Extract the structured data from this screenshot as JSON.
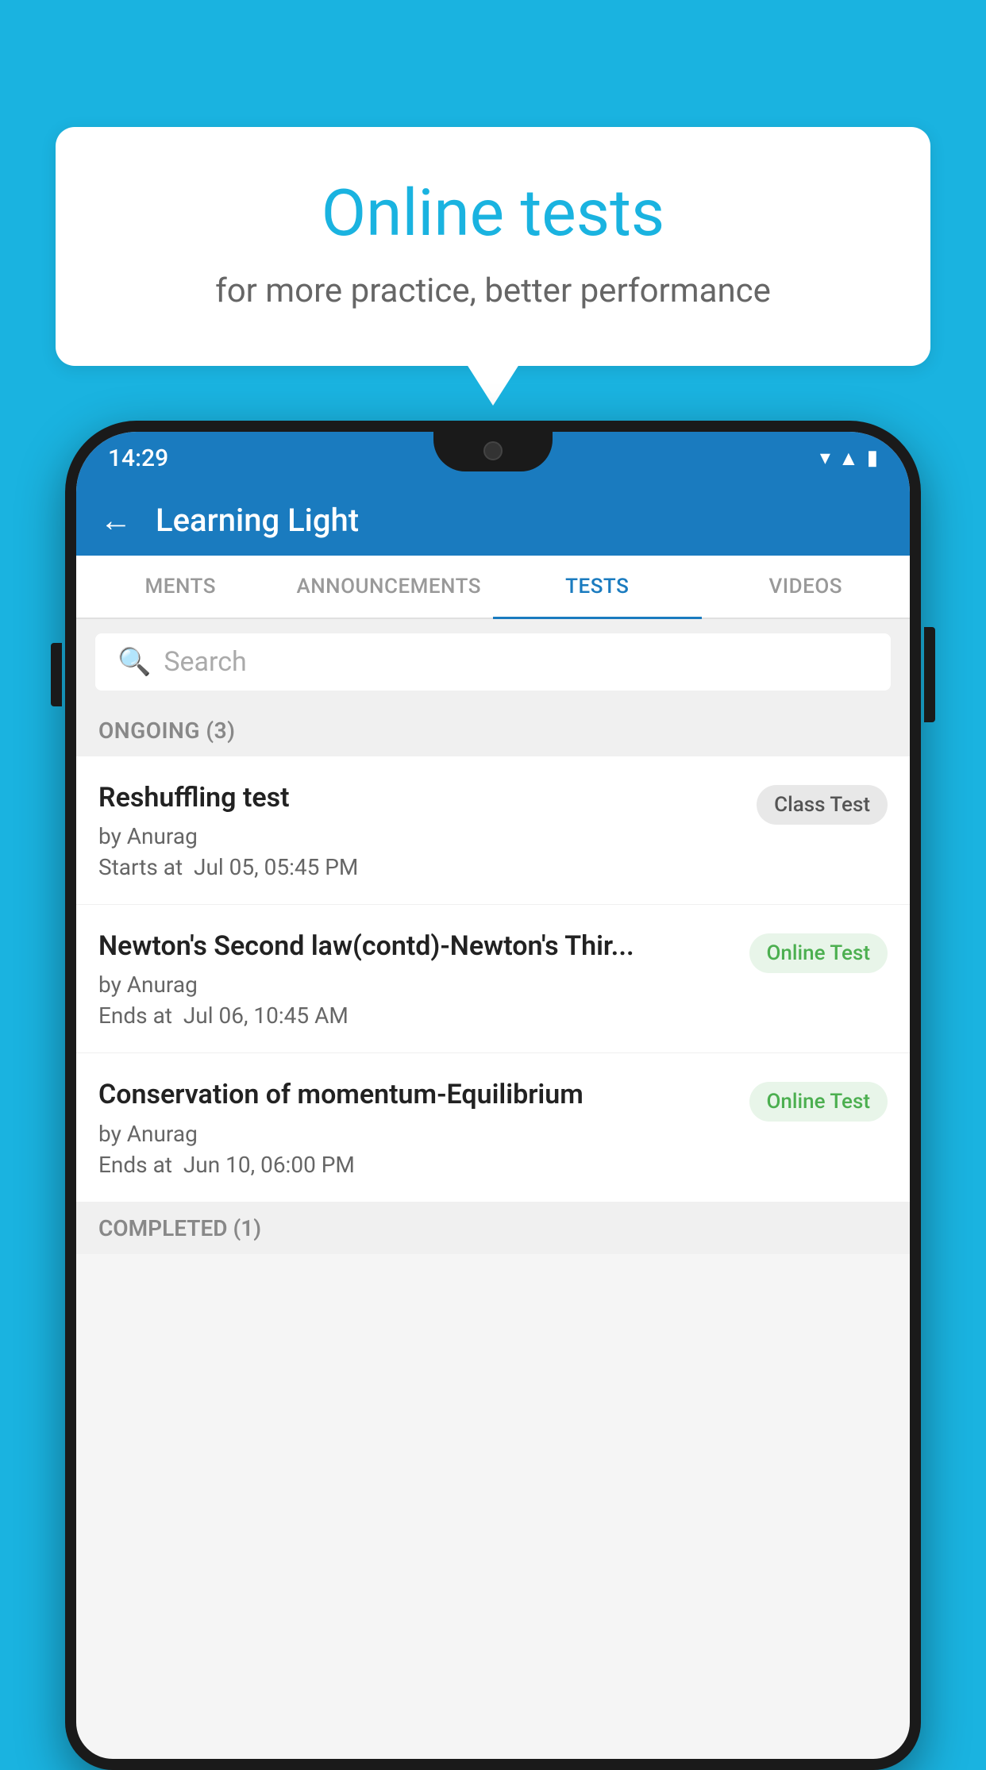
{
  "background_color": "#1ab3e0",
  "speech_bubble": {
    "title": "Online tests",
    "subtitle": "for more practice, better performance"
  },
  "phone": {
    "status_bar": {
      "time": "14:29",
      "wifi_icon": "▾",
      "signal_icon": "▲",
      "battery_icon": "▮"
    },
    "header": {
      "back_label": "←",
      "title": "Learning Light"
    },
    "tabs": [
      {
        "label": "MENTS",
        "active": false
      },
      {
        "label": "ANNOUNCEMENTS",
        "active": false
      },
      {
        "label": "TESTS",
        "active": true
      },
      {
        "label": "VIDEOS",
        "active": false
      }
    ],
    "search": {
      "placeholder": "Search"
    },
    "ongoing_section": {
      "title": "ONGOING (3)"
    },
    "tests": [
      {
        "name": "Reshuffling test",
        "author": "by Anurag",
        "time_label": "Starts at",
        "time_value": "Jul 05, 05:45 PM",
        "badge": "Class Test",
        "badge_type": "class"
      },
      {
        "name": "Newton's Second law(contd)-Newton's Thir...",
        "author": "by Anurag",
        "time_label": "Ends at",
        "time_value": "Jul 06, 10:45 AM",
        "badge": "Online Test",
        "badge_type": "online"
      },
      {
        "name": "Conservation of momentum-Equilibrium",
        "author": "by Anurag",
        "time_label": "Ends at",
        "time_value": "Jun 10, 06:00 PM",
        "badge": "Online Test",
        "badge_type": "online"
      }
    ],
    "completed_section": {
      "title": "COMPLETED (1)"
    }
  }
}
